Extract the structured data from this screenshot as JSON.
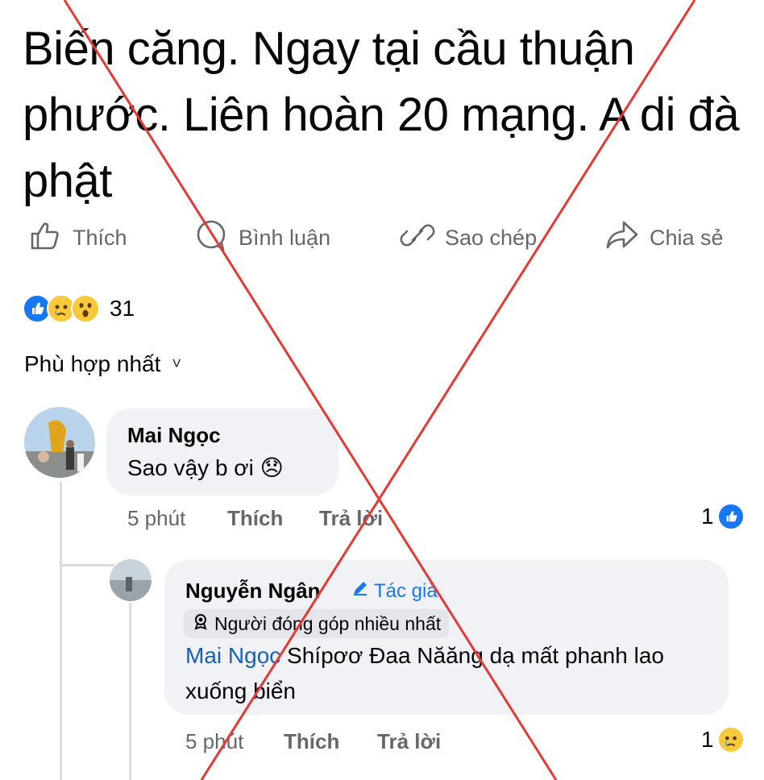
{
  "post": {
    "title": "Biến căng. Ngay tại cầu thuận phước. Liên hoàn 20 mạng. A di đà phật"
  },
  "actions": {
    "like": "Thích",
    "comment": "Bình luận",
    "copy": "Sao chép",
    "share": "Chia sẻ"
  },
  "reactions": {
    "count": "31",
    "icons": [
      "like-icon",
      "sad-icon",
      "wow-icon"
    ]
  },
  "sort": {
    "label": "Phù hợp nhất",
    "chevron": "˅"
  },
  "comments": [
    {
      "author": "Mai Ngọc",
      "text": "Sao vậy b ơi 😞",
      "time": "5 phút",
      "like": "Thích",
      "reply": "Trả lời",
      "reaction_count": "1",
      "reaction_icon": "like-icon"
    },
    {
      "author": "Nguyễn Ngân",
      "author_badge": "Tác giả",
      "contributor_badge": "Người đóng góp nhiều nhất",
      "mention": "Mai Ngọc",
      "text": " Shípơơ Đaa Năăng dạ mất phanh lao xuống biển",
      "time": "5 phút",
      "like": "Thích",
      "reply": "Trả lời",
      "reaction_count": "1",
      "reaction_icon": "sad-icon"
    }
  ],
  "overlay": {
    "type": "red-x-cross",
    "color": "#e53935"
  }
}
